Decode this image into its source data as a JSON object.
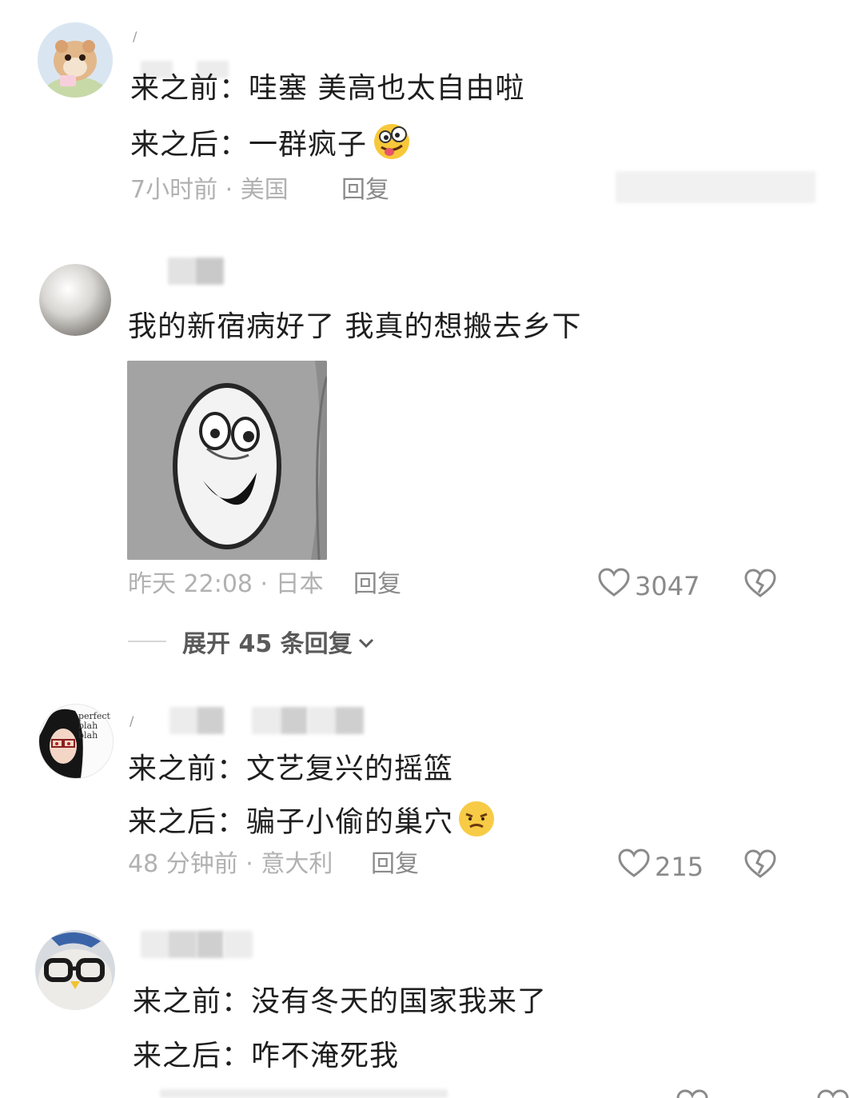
{
  "comments": [
    {
      "lines": [
        "来之前：哇塞 美高也太自由啦",
        "来之后：一群疯子"
      ],
      "time_location": "7小时前 · 美国",
      "reply_label": "回复",
      "avatar_icon": "hamster-avatar-icon",
      "emoji": "crazy-face-emoji"
    },
    {
      "lines": [
        "我的新宿病好了 我真的想搬去乡下"
      ],
      "time_location": "昨天 22:08 · 日本",
      "reply_label": "回复",
      "likes": "3047",
      "expand_label": "展开 45 条回复",
      "avatar_icon": "pearl-avatar-icon",
      "image_icon": "ghost-face-meme-image"
    },
    {
      "lines": [
        "来之前：文艺复兴的摇篮",
        "来之后：骗子小偷的巢穴"
      ],
      "time_location": "48 分钟前 · 意大利",
      "reply_label": "回复",
      "likes": "215",
      "avatar_icon": "anime-girl-avatar-icon",
      "avatar_text": [
        "perfect",
        "blah",
        "blah"
      ],
      "emoji": "annoyed-face-emoji"
    },
    {
      "lines": [
        "来之前：没有冬天的国家我来了",
        "来之后：咋不淹死我"
      ],
      "avatar_icon": "glasses-avatar-icon"
    }
  ],
  "colors": {
    "text": "#1e1e1e",
    "meta": "#b1b1b1",
    "action": "#8a8a8a"
  }
}
